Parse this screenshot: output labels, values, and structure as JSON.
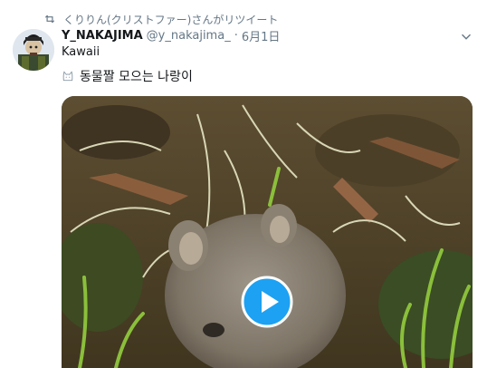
{
  "retweet": {
    "icon": "retweet-icon",
    "text": "くりりん(クリストファー)さんがリツイート"
  },
  "author": {
    "display_name": "Y_NAKAJIMA",
    "handle": "@y_nakajima_",
    "separator": "·",
    "date": "6月1日",
    "avatar_icon": "profile-avatar"
  },
  "tweet": {
    "text_line1": "Kawaii",
    "text_line2": "동물짤 모으는 나랑이",
    "emoji_icon": "cat-face-icon",
    "menu_icon": "chevron-down-icon"
  },
  "media": {
    "type": "video",
    "play_icon": "play-button-icon",
    "accent": "#1da1f2"
  },
  "colors": {
    "text_primary": "#14171a",
    "text_secondary": "#657786",
    "accent": "#1da1f2"
  }
}
